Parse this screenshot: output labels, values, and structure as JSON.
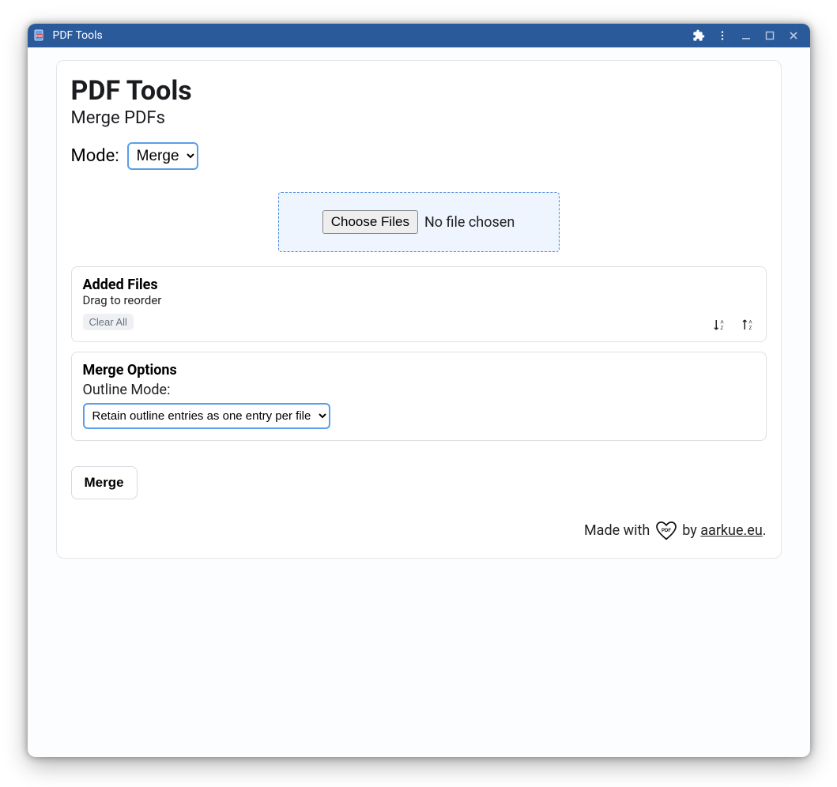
{
  "window": {
    "title": "PDF Tools"
  },
  "page": {
    "title": "PDF Tools",
    "subtitle": "Merge PDFs"
  },
  "mode": {
    "label": "Mode:",
    "selected": "Merge"
  },
  "fileInput": {
    "buttonLabel": "Choose Files",
    "status": "No file chosen"
  },
  "addedFiles": {
    "title": "Added Files",
    "hint": "Drag to reorder",
    "clearLabel": "Clear All"
  },
  "mergeOptions": {
    "title": "Merge Options",
    "outlineLabel": "Outline Mode:",
    "outlineSelected": "Retain outline entries as one entry per file"
  },
  "actions": {
    "mergeLabel": "Merge"
  },
  "footer": {
    "madeWith": "Made with ",
    "by": " by ",
    "link": "aarkue.eu",
    "period": "."
  }
}
